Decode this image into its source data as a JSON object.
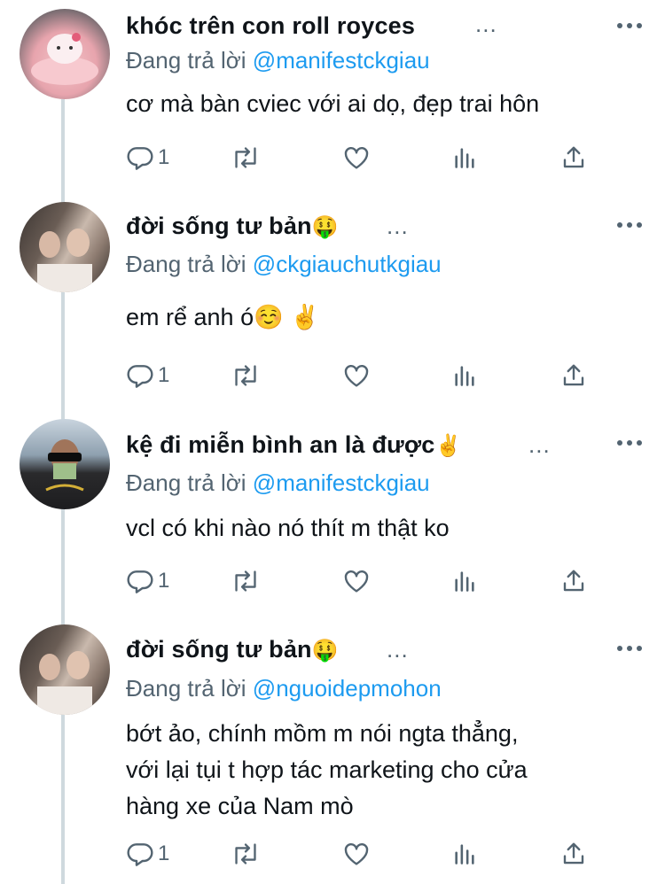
{
  "ui": {
    "more_glyph": "...",
    "replying_prefix": "Đang trả lời",
    "icons": [
      "reply-icon",
      "retweet-icon",
      "like-icon",
      "views-icon",
      "share-icon",
      "more-icon"
    ],
    "colors": {
      "link": "#1d9bf0",
      "muted": "#536471",
      "thread_line": "#cfd9de"
    }
  },
  "tweets": [
    {
      "display_name": "khóc trên con roll royces",
      "name_emoji": "",
      "replying_to": "@manifestckgiau",
      "text": "cơ mà bàn cviec với ai dọ, đẹp trai hôn",
      "reply_count": "1"
    },
    {
      "display_name": "đời sống tư bản",
      "name_emoji": "🤑",
      "replying_to": "@ckgiauchutkgiau",
      "text": "em rể anh ó☺️ ✌️",
      "reply_count": "1"
    },
    {
      "display_name": "kệ đi miễn bình an là được",
      "name_emoji": "✌️",
      "replying_to": "@manifestckgiau",
      "text": "vcl có khi nào nó thít m thật ko",
      "reply_count": "1"
    },
    {
      "display_name": "đời sống tư bản",
      "name_emoji": "🤑",
      "replying_to": "@nguoidepmohon",
      "text": "bớt ảo, chính mồm m nói ngta thẳng,\nvới lại tụi t hợp tác marketing cho cửa\nhàng xe của Nam mò",
      "reply_count": "1"
    }
  ]
}
